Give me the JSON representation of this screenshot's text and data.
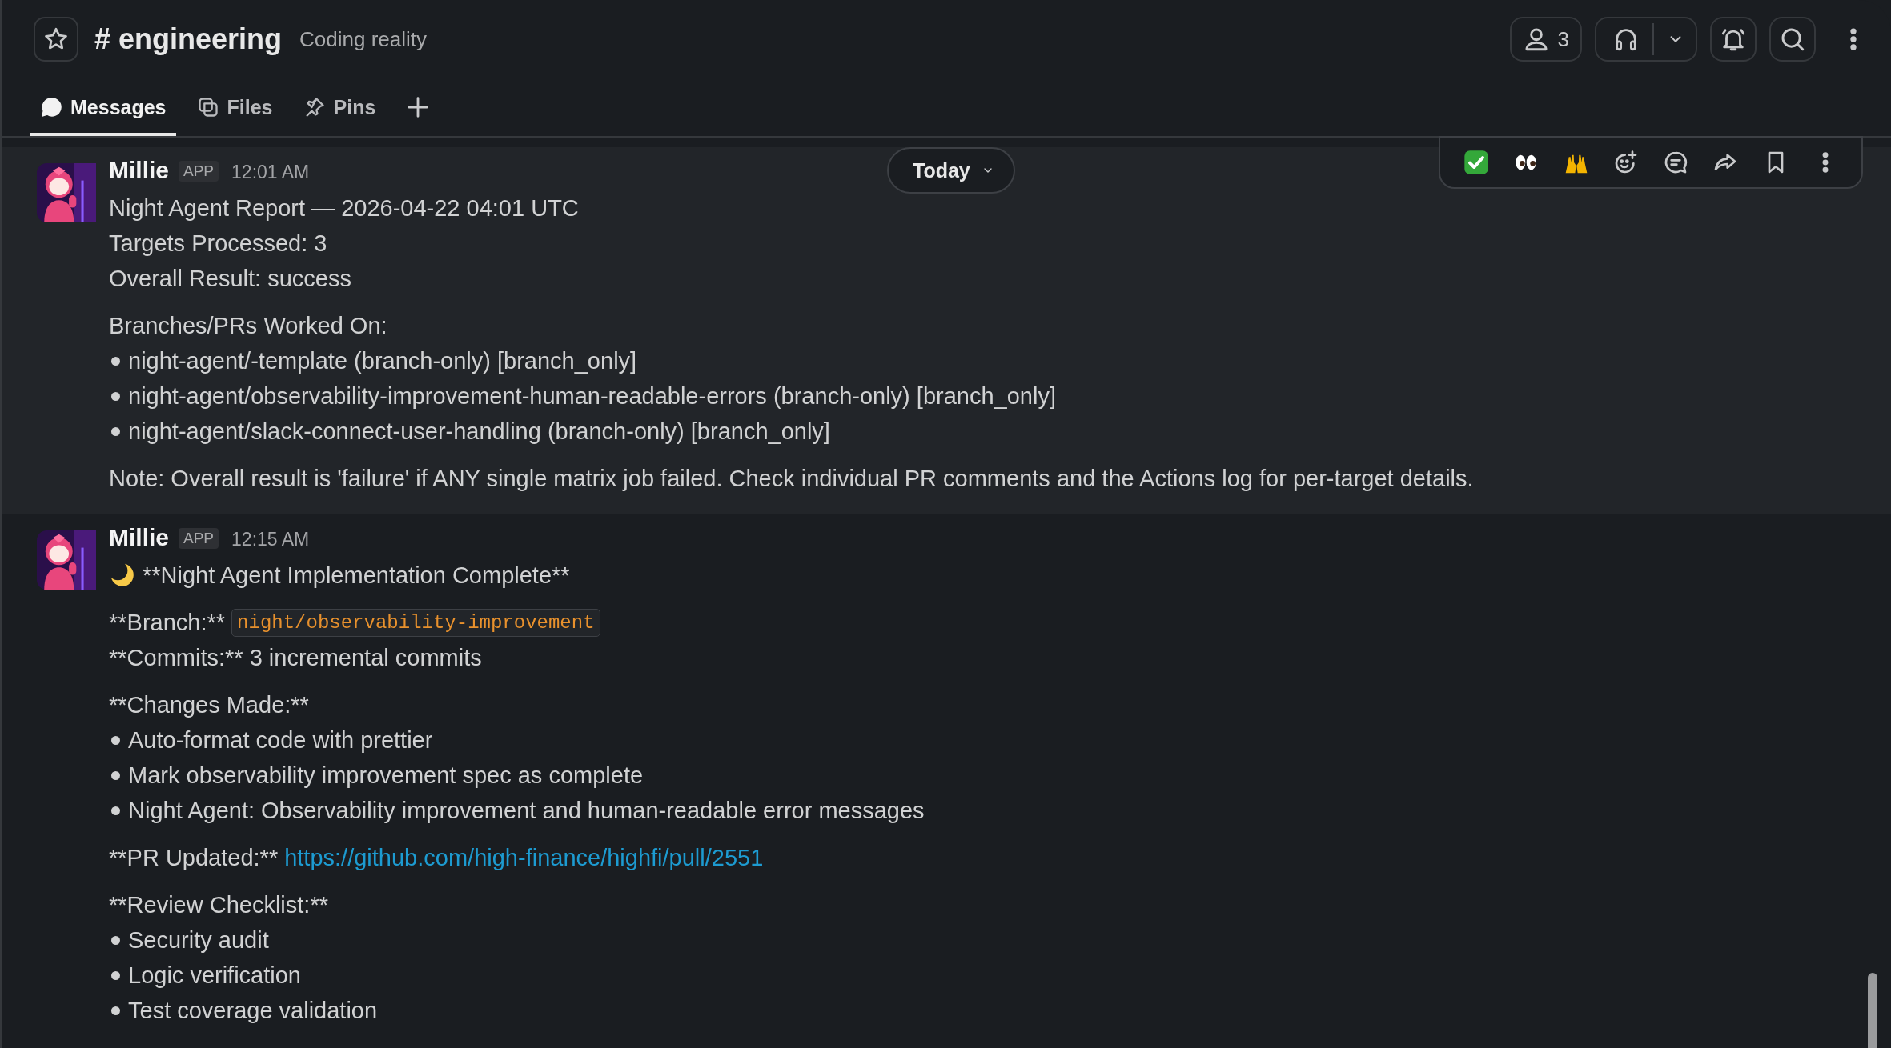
{
  "channel": {
    "hash": "#",
    "name": "engineering",
    "topic": "Coding reality"
  },
  "header_actions": {
    "members_count": "3"
  },
  "tabs": [
    {
      "label": "Messages",
      "selected": true
    },
    {
      "label": "Files",
      "selected": false
    },
    {
      "label": "Pins",
      "selected": false
    }
  ],
  "date_divider": {
    "label": "Today"
  },
  "messages": [
    {
      "author": "Millie",
      "badge": "APP",
      "time": "12:01 AM",
      "hovered": true,
      "paragraphs": [
        [
          {
            "kind": "text",
            "text": "Night Agent Report — 2026-04-22 04:01 UTC"
          },
          {
            "kind": "text",
            "text": "Targets Processed: 3"
          },
          {
            "kind": "text",
            "text": "Overall Result: success"
          }
        ],
        [
          {
            "kind": "text",
            "text": "Branches/PRs Worked On:"
          },
          {
            "kind": "bullet",
            "text": "night-agent/-template (branch-only) [branch_only]"
          },
          {
            "kind": "bullet",
            "text": "night-agent/observability-improvement-human-readable-errors (branch-only) [branch_only]"
          },
          {
            "kind": "bullet",
            "text": "night-agent/slack-connect-user-handling (branch-only) [branch_only]"
          }
        ],
        [
          {
            "kind": "text",
            "text": "Note: Overall result is 'failure' if ANY single matrix job failed. Check individual PR comments and the Actions log for per-target details."
          }
        ]
      ]
    },
    {
      "author": "Millie",
      "badge": "APP",
      "time": "12:15 AM",
      "hovered": false,
      "paragraphs": [
        [
          {
            "kind": "heading",
            "text": "**Night Agent Implementation Complete**"
          }
        ],
        [
          {
            "kind": "text",
            "text": "**Branch:**",
            "code": "night/observability-improvement"
          },
          {
            "kind": "text",
            "text": "**Commits:** 3 incremental commits"
          }
        ],
        [
          {
            "kind": "text",
            "text": "**Changes Made:**"
          },
          {
            "kind": "bullet",
            "text": "Auto-format code with prettier"
          },
          {
            "kind": "bullet",
            "text": "Mark observability improvement spec as complete"
          },
          {
            "kind": "bullet",
            "text": "Night Agent: Observability improvement and human-readable error messages"
          }
        ],
        [
          {
            "kind": "text",
            "text": "**PR Updated:**",
            "link": "https://github.com/high-finance/highfi/pull/2551"
          }
        ],
        [
          {
            "kind": "text",
            "text": "**Review Checklist:**"
          },
          {
            "kind": "bullet",
            "text": "Security audit"
          },
          {
            "kind": "bullet",
            "text": "Logic verification"
          },
          {
            "kind": "bullet",
            "text": "Test coverage validation"
          }
        ]
      ]
    }
  ]
}
